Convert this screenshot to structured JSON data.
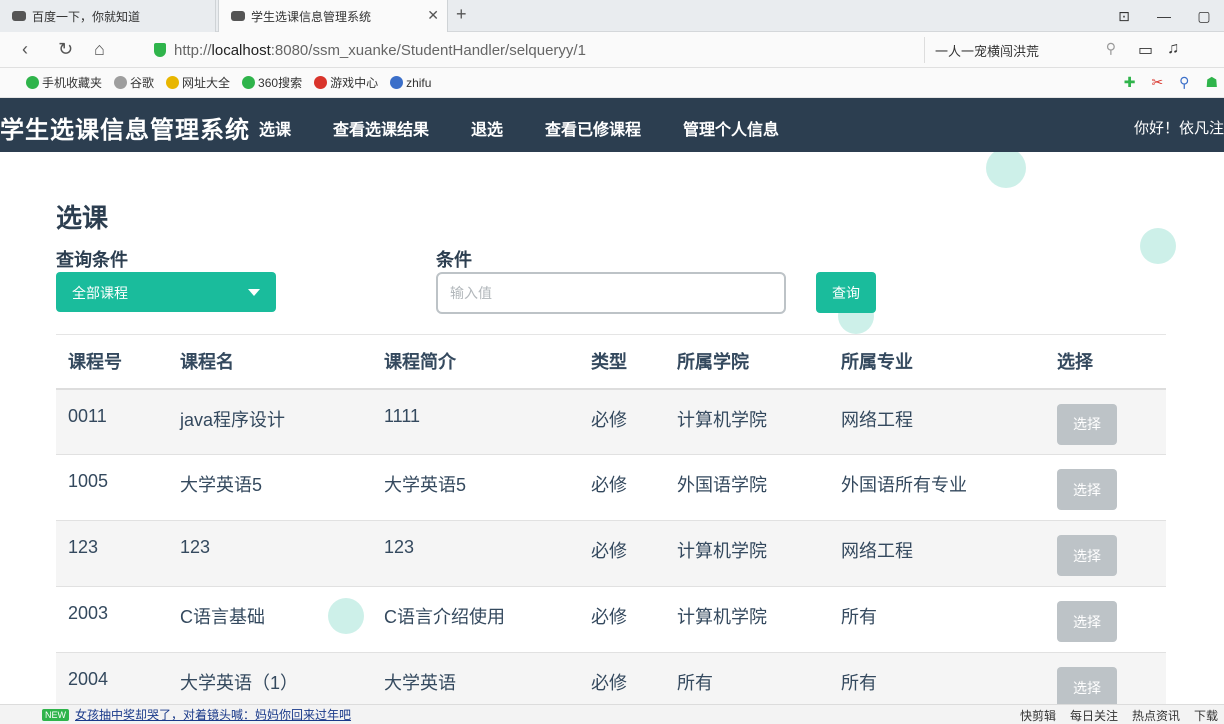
{
  "browser": {
    "tabs": [
      {
        "title": "百度一下，你就知道",
        "active": false
      },
      {
        "title": "学生选课信息管理系统",
        "active": true
      }
    ],
    "new_tab": "+",
    "window_controls": [
      "⊡",
      "—",
      "▢"
    ],
    "url_prefix": "http://",
    "url_host": "localhost",
    "url_rest": ":8080/ssm_xuanke/StudentHandler/selqueryy/1",
    "search_text": "一人一宠横闯洪荒",
    "bookmarks": [
      {
        "label": "手机收藏夹",
        "color": "#2fb44b"
      },
      {
        "label": "谷歌",
        "color": "#9e9e9e"
      },
      {
        "label": "网址大全",
        "color": "#e8b600"
      },
      {
        "label": "360搜索",
        "color": "#2fb44b"
      },
      {
        "label": "游戏中心",
        "color": "#d9342b"
      },
      {
        "label": "zhifu",
        "color": "#3b6fc9"
      }
    ]
  },
  "app": {
    "brand": "学生选课信息管理系统",
    "nav": [
      "选课",
      "查看选课结果",
      "退选",
      "查看已修课程",
      "管理个人信息"
    ],
    "greeting": "你好！依凡注",
    "page_title": "选课",
    "query_label": "查询条件",
    "select_value": "全部课程",
    "condition_label": "条件",
    "input_placeholder": "输入值",
    "query_button": "查询",
    "columns": [
      "课程号",
      "课程名",
      "课程简介",
      "类型",
      "所属学院",
      "所属专业",
      "选择"
    ],
    "rows": [
      {
        "id": "0011",
        "name": "java程序设计",
        "intro": "1111",
        "type": "必修",
        "college": "计算机学院",
        "major": "网络工程",
        "action": "选择"
      },
      {
        "id": "1005",
        "name": "大学英语5",
        "intro": "大学英语5",
        "type": "必修",
        "college": "外国语学院",
        "major": "外国语所有专业",
        "action": "选择"
      },
      {
        "id": "123",
        "name": "123",
        "intro": "123",
        "type": "必修",
        "college": "计算机学院",
        "major": "网络工程",
        "action": "选择"
      },
      {
        "id": "2003",
        "name": "C语言基础",
        "intro": "C语言介绍使用",
        "type": "必修",
        "college": "计算机学院",
        "major": "所有",
        "action": "选择"
      },
      {
        "id": "2004",
        "name": "大学英语（1）",
        "intro": "大学英语",
        "type": "必修",
        "college": "所有",
        "major": "所有",
        "action": "选择"
      }
    ]
  },
  "statusbar": {
    "badge": "NEW",
    "news": "女孩抽中奖却哭了，对着镜头喊：妈妈你回来过年吧",
    "items": [
      "快剪辑",
      "每日关注",
      "热点资讯",
      "下载"
    ]
  },
  "colors": {
    "nav_bg": "#2c3e50",
    "accent": "#1abc9c",
    "disabled_btn": "#bdc3c7"
  }
}
